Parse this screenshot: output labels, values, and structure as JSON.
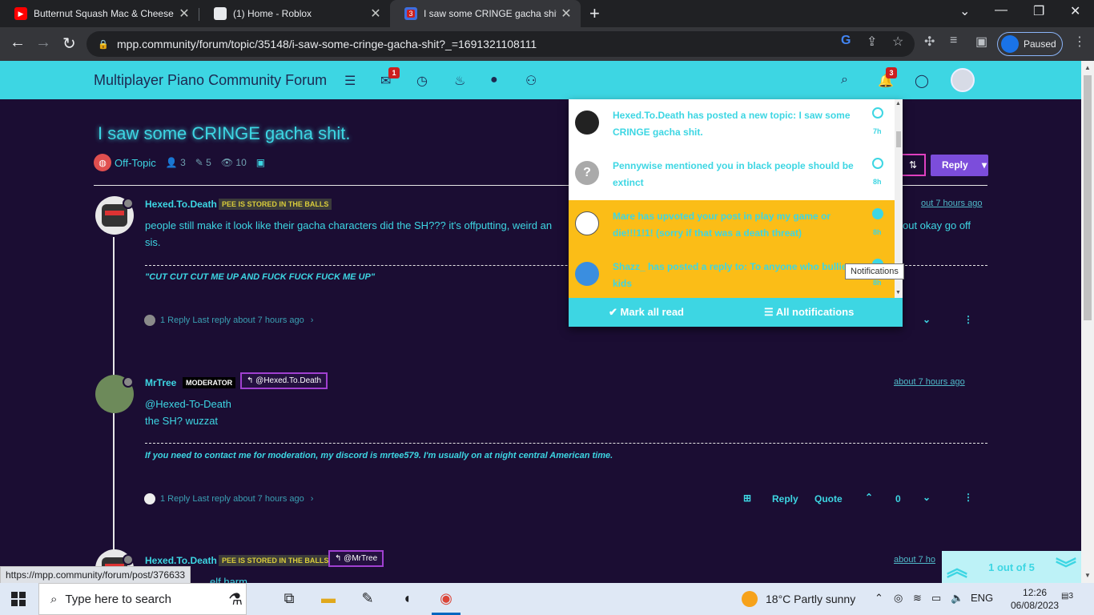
{
  "browser": {
    "tabs": [
      {
        "title": "Butternut Squash Mac & Cheese",
        "favicon": "youtube-icon"
      },
      {
        "title": "(1) Home - Roblox",
        "favicon": "roblox-icon"
      },
      {
        "title": "I saw some CRINGE gacha shit. | ",
        "favicon": "forum-icon",
        "favicon_badge": "3"
      }
    ],
    "url": "mpp.community/forum/topic/35148/i-saw-some-cringe-gacha-shit?_=1691321108111",
    "profile_status": "Paused"
  },
  "forum": {
    "brand": "Multiplayer Piano Community Forum",
    "unread_badge": "1",
    "notif_badge": "3"
  },
  "topic": {
    "title": "I saw some CRINGE gacha shit.",
    "category": "Off-Topic",
    "posters": "3",
    "posts": "5",
    "views": "10",
    "reply_button": "Reply"
  },
  "posts": [
    {
      "author": "Hexed.To.Death",
      "badge": "PEE IS STORED IN THE BALLS",
      "text_line1": "people still make it look like their gacha characters did the SH??? it's offputting, weird an",
      "text_line1_tail": "out okay go off",
      "text_line2": "sis.",
      "timestamp": "out 7 hours ago",
      "signature": "\"CUT CUT CUT ME UP AND FUCK FUCK FUCK ME UP\"",
      "replies": "1 Reply Last reply about 7 hours ago"
    },
    {
      "author": "MrTree",
      "badge": "MODERATOR",
      "reply_to": "@Hexed.To.Death",
      "text_line1": "@Hexed-To-Death",
      "text_line2": "the SH? wuzzat",
      "timestamp": "about 7 hours ago",
      "signature_pre": "If you need to contact me for moderation, my discord is ",
      "signature_bold": "mrtee579",
      "signature_post": ". I'm usually on at night central American time.",
      "replies": "1 Reply Last reply about 7 hours ago",
      "actions": {
        "reply": "Reply",
        "quote": "Quote",
        "votes": "0"
      }
    },
    {
      "author": "Hexed.To.Death",
      "badge": "PEE IS STORED IN THE BALLS",
      "reply_to": "@MrTree",
      "timestamp": "about 7 ho",
      "text_line1": "elf harm"
    }
  ],
  "notifications": {
    "items": [
      {
        "actor": "Hexed.To.Death",
        "text": "Hexed.To.Death has posted a new topic: I saw some CRINGE gacha shit.",
        "time": "7h",
        "unread": false
      },
      {
        "actor": "Pennywise",
        "text": "Pennywise mentioned you in black people should be extinct",
        "time": "8h",
        "unread": false
      },
      {
        "actor": "Mare",
        "text": "Mare has upvoted your post in play my game or die!!!1!1! (sorry if that was a death threat)",
        "time": "8h",
        "unread": true
      },
      {
        "actor": "Shazz_",
        "text": "Shazz_ has posted a reply to: To anyone who bullies kids",
        "time": "8h",
        "unread": true
      }
    ],
    "mark_all": "Mark all read",
    "all_notifications": "All notifications",
    "tooltip": "Notifications"
  },
  "pager": {
    "text": "1 out of 5"
  },
  "status_url": "https://mpp.community/forum/post/376633",
  "taskbar": {
    "search_placeholder": "Type here to search",
    "weather": "18°C  Partly sunny",
    "lang": "ENG",
    "time": "12:26",
    "date": "06/08/2023",
    "notif_count": "3"
  },
  "colors": {
    "accent": "#3dd6e3",
    "page_bg": "#1b0d33",
    "unread": "#fbbd17",
    "reply_btn": "#7c4ddb"
  }
}
